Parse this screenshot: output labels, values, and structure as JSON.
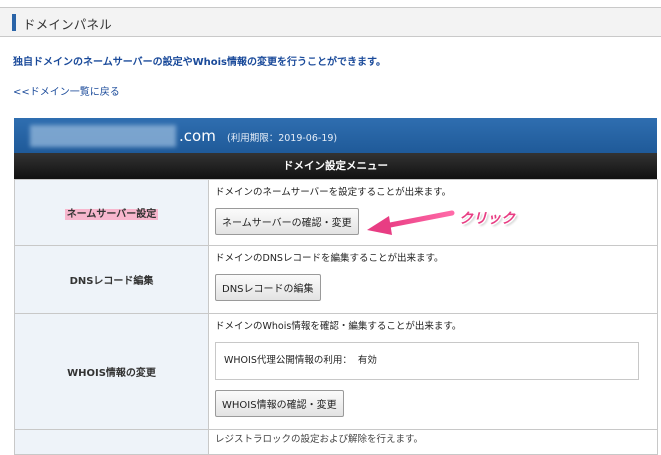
{
  "panel": {
    "title": "ドメインパネル"
  },
  "description": "独自ドメインのネームサーバーの設定やWhois情報の変更を行うことができます。",
  "back_link": "<<ドメイン一覧に戻る",
  "domain": {
    "tld": ".com",
    "expiry": "(利用期限：2019-06-19)"
  },
  "menu": {
    "header": "ドメイン設定メニュー",
    "rows": [
      {
        "label": "ネームサーバー設定",
        "text": "ドメインのネームサーバーを設定することが出来ます。",
        "button": "ネームサーバーの確認・変更"
      },
      {
        "label": "DNSレコード編集",
        "text": "ドメインのDNSレコードを編集することが出来ます。",
        "button": "DNSレコードの編集"
      },
      {
        "label": "WHOIS情報の変更",
        "text": "ドメインのWhois情報を確認・編集することが出来ます。",
        "whois_label": "WHOIS代理公開情報の利用：",
        "whois_value": "有効",
        "button": "WHOIS情報の確認・変更"
      }
    ],
    "partial_text": "レジストラロックの設定および解除を行えます。"
  },
  "annotation": {
    "text": "クリック",
    "color": "#e83d83"
  }
}
